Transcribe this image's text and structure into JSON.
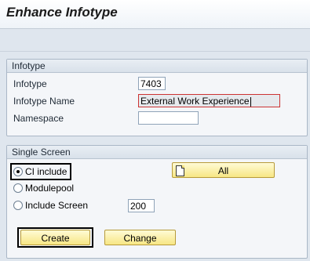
{
  "window": {
    "title": "Enhance Infotype"
  },
  "infotype_group": {
    "title": "Infotype",
    "fields": {
      "infotype": {
        "label": "Infotype",
        "value": "7403"
      },
      "infotype_name": {
        "label": "Infotype Name",
        "value": "External Work Experience"
      },
      "namespace": {
        "label": "Namespace",
        "value": ""
      }
    }
  },
  "single_screen_group": {
    "title": "Single Screen",
    "options": {
      "ci_include": {
        "label": "CI include",
        "selected": true
      },
      "modulepool": {
        "label": "Modulepool",
        "selected": false
      },
      "include_screen": {
        "label": "Include Screen",
        "selected": false,
        "value": "200"
      }
    },
    "all_button": {
      "label": "All",
      "icon": "document-icon"
    }
  },
  "buttons": {
    "create": "Create",
    "change": "Change"
  },
  "colors": {
    "background": "#dfe6ee",
    "button_yellow": "#f7e684",
    "required_marker": "#cc3333"
  }
}
